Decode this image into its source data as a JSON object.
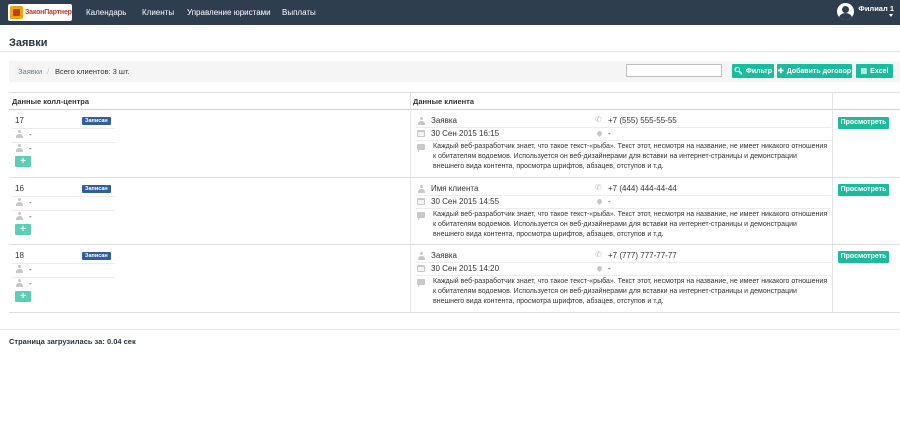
{
  "navbar": {
    "logo_text": "ЗаконПартнер",
    "items": [
      "Календарь",
      "Клиенты",
      "Управление юристами",
      "Выплаты"
    ],
    "branch": "Филиал 1"
  },
  "page": {
    "title": "Заявки"
  },
  "toolbar": {
    "breadcrumb_link": "Заявки",
    "breadcrumb_sep": "/",
    "count_text": "Всего клиентов: 3 шт.",
    "search_value": "",
    "filter_label": "Фильтр",
    "add_label": "Добавить договор",
    "excel_label": "Excel"
  },
  "table": {
    "col_callcenter": "Данные колл-центра",
    "col_client": "Данные клиента",
    "rows": [
      {
        "number": "17",
        "status": "Записан",
        "cc_line1": "-",
        "cc_line2": "-",
        "add_label": "+",
        "client_name": "Заявка",
        "date": "30 Сен 2015 16:15",
        "phone": "+7 (555) 555-55-55",
        "address": "-",
        "description": "Каждый веб-разработчик знает, что такое текст-«рыба». Текст этот, несмотря на название, не имеет никакого отношения к обитателям водоемов. Используется он веб-дизайнерами для вставки на интернет-страницы и демонстрации внешнего вида контента, просмотра шрифтов, абзацев, отступов и т.д.",
        "view_label": "Просмотреть"
      },
      {
        "number": "16",
        "status": "Записан",
        "cc_line1": "-",
        "cc_line2": "-",
        "add_label": "+",
        "client_name": "Имя клиента",
        "date": "30 Сен 2015 14:55",
        "phone": "+7 (444) 444-44-44",
        "address": "-",
        "description": "Каждый веб-разработчик знает, что такое текст-«рыба». Текст этот, несмотря на название, не имеет никакого отношения к обитателям водоемов. Используется он веб-дизайнерами для вставки на интернет-страницы и демонстрации внешнего вида контента, просмотра шрифтов, абзацев, отступов и т.д.",
        "view_label": "Просмотреть"
      },
      {
        "number": "18",
        "status": "Записан",
        "cc_line1": "-",
        "cc_line2": "-",
        "add_label": "+",
        "client_name": "Заявка",
        "date": "30 Сен 2015 14:20",
        "phone": "+7 (777) 777-77-77",
        "address": "-",
        "description": "Каждый веб-разработчик знает, что такое текст-«рыба». Текст этот, несмотря на название, не имеет никакого отношения к обитателям водоемов. Используется он веб-дизайнерами для вставки на интернет-страницы и демонстрации внешнего вида контента, просмотра шрифтов, абзацев, отступов и т.д.",
        "view_label": "Просмотреть"
      }
    ]
  },
  "footer": {
    "load_time": "Страница загрузилась за: 0.04 сек"
  },
  "colors": {
    "navbar": "#2f3e4e",
    "accent": "#1abc9c",
    "badge": "#2f5fa0"
  }
}
